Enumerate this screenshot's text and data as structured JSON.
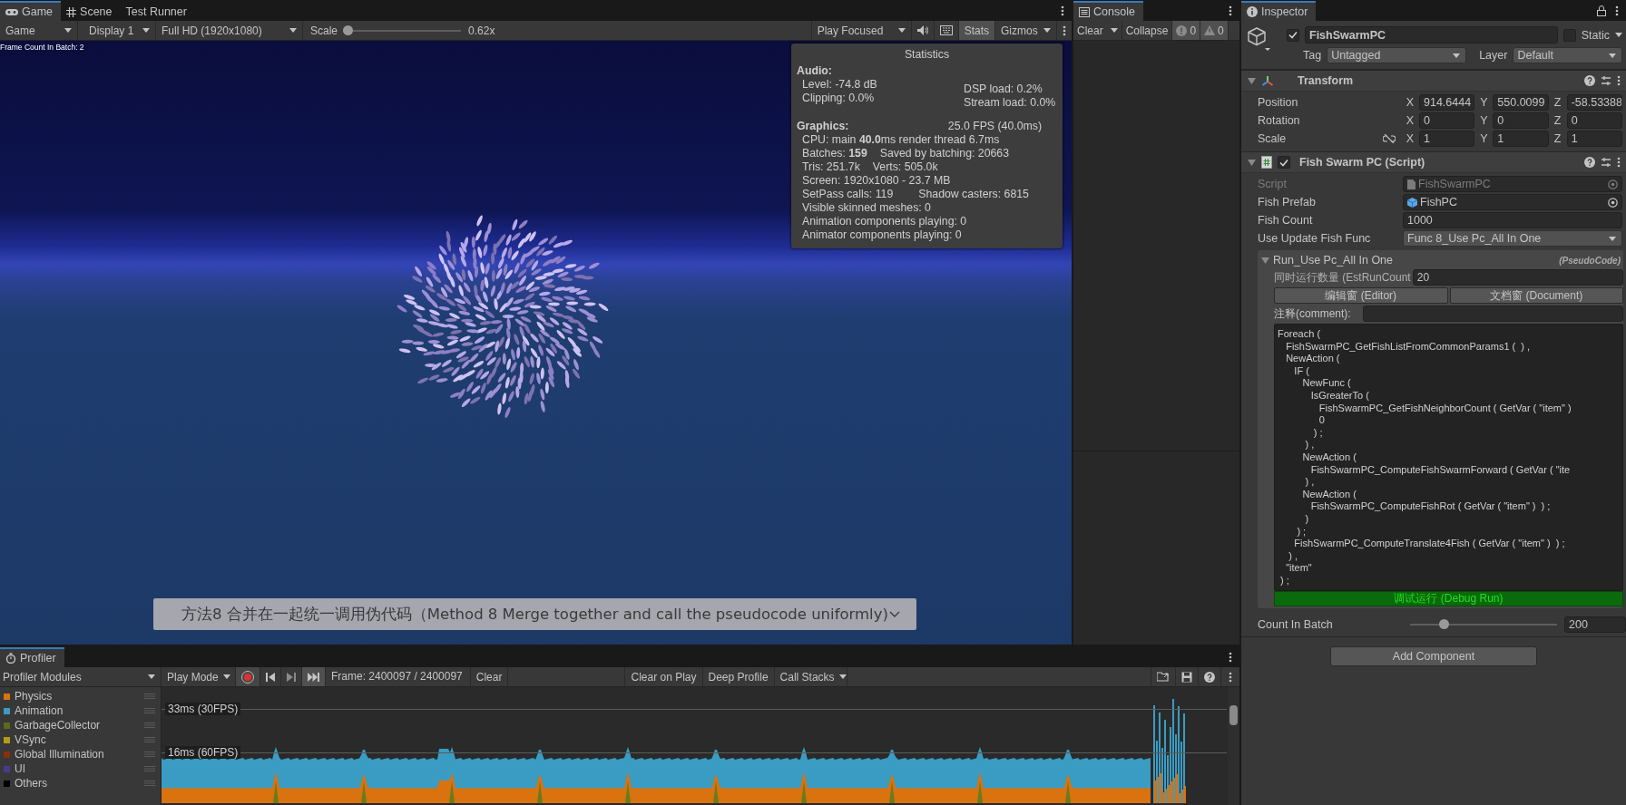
{
  "game": {
    "tabs": [
      {
        "label": "Game",
        "selected": true
      },
      {
        "label": "Scene",
        "selected": false
      },
      {
        "label": "Test Runner",
        "selected": false
      }
    ],
    "toolbar": {
      "view": "Game",
      "display": "Display 1",
      "resolution": "Full HD (1920x1080)",
      "scale_label": "Scale",
      "scale": {
        "level": 0,
        "reading": "0.62x"
      },
      "play_mode": "Play Focused",
      "stats": {
        "label": "Stats",
        "selected": true
      },
      "gizmos": "Gizmos"
    },
    "overlay_text": "Frame Count In Batch: 2",
    "statistics": {
      "title": "Statistics",
      "audio_heading": "Audio:",
      "audio_left": [
        "Level: -74.8 dB",
        "Clipping: 0.0%"
      ],
      "audio_right": [
        "DSP load: 0.2%",
        "Stream load: 0.0%"
      ],
      "graphics_heading": "Graphics:",
      "fps": "25.0 FPS (40.0ms)",
      "rows": [
        [
          "CPU: main **40.0**ms  render thread 6.7ms"
        ],
        [
          "Batches: **159**",
          "Saved by batching: 20663"
        ],
        [
          "Tris: 251.7k",
          "Verts: 505.0k"
        ],
        [
          "Screen: 1920x1080 - 23.7 MB"
        ],
        [
          "SetPass calls: 119",
          "Shadow casters: 6815"
        ],
        [
          "Visible skinned meshes: 0"
        ],
        [
          "Animation components playing: 0"
        ],
        [
          "Animator components playing: 0"
        ]
      ]
    },
    "caption": "方法8 合并在一起统一调用伪代码（Method 8 Merge together and call the pseudocode uniformly)"
  },
  "console": {
    "tab": "Console",
    "clear": "Clear",
    "collapse": "Collapse",
    "errors": "0",
    "warnings": "0"
  },
  "inspector": {
    "tab": "Inspector",
    "object": {
      "active": true,
      "name": "FishSwarmPC",
      "static": false,
      "static_label": "Static",
      "tag_label": "Tag",
      "tag": "Untagged",
      "layer_label": "Layer",
      "layer": "Default"
    },
    "transform": {
      "title": "Transform",
      "expanded": true,
      "rows": [
        {
          "label": "Position",
          "fields": [
            {
              "axis": "X",
              "value": "914.6444"
            },
            {
              "axis": "Y",
              "value": "550.0099"
            },
            {
              "axis": "Z",
              "value": "-58.53388"
            }
          ]
        },
        {
          "label": "Rotation",
          "fields": [
            {
              "axis": "X",
              "value": "0"
            },
            {
              "axis": "Y",
              "value": "0"
            },
            {
              "axis": "Z",
              "value": "0"
            }
          ]
        },
        {
          "label": "Scale",
          "fields": [
            {
              "axis": "X",
              "value": "1"
            },
            {
              "axis": "Y",
              "value": "1"
            },
            {
              "axis": "Z",
              "value": "1"
            }
          ]
        }
      ]
    },
    "script": {
      "title": "Fish Swarm PC (Script)",
      "enabled": true,
      "expanded": true,
      "fields": [
        {
          "kind": "object",
          "label": "Script",
          "value": "FishSwarmPC",
          "disabled": true
        },
        {
          "kind": "object",
          "label": "Fish Prefab",
          "value": "FishPC",
          "disabled": false
        },
        {
          "kind": "text",
          "label": "Fish Count",
          "value": "1000",
          "disabled": false
        },
        {
          "kind": "dropdown",
          "label": "Use Update Fish Func",
          "value": "Func 8_Use Pc_All In One",
          "disabled": false
        }
      ],
      "pseudocode": {
        "title": "Run_Use Pc_All In One",
        "tag": "(PseudoCode)",
        "expanded": true,
        "run_count_label": "同时运行数量 (EstRunCount",
        "run_count": "20",
        "editor_button": "编辑窗 (Editor)",
        "document_button": "文档窗 (Document)",
        "comment_label": "注释(comment):",
        "code": [
          "Foreach (",
          "   FishSwarmPC_GetFishListFromCommonParams1 (  ) ,",
          "   NewAction (",
          "      IF (",
          "         NewFunc (",
          "            IsGreaterTo (",
          "               FishSwarmPC_GetFishNeighborCount ( GetVar ( \"item\" )",
          "               0",
          "             ) ;",
          "          ) ,",
          "         NewAction (",
          "            FishSwarmPC_ComputeFishSwarmForward ( GetVar ( \"ite",
          "          ) ,",
          "         NewAction (",
          "            FishSwarmPC_ComputeFishRot ( GetVar ( \"item\" )  ) ;",
          "          )",
          "       ) ;",
          "      FishSwarmPC_ComputeTranslate4Fish ( GetVar ( \"item\" )  ) ;",
          "    ) ,",
          "   \"item\"",
          " ) ;"
        ],
        "debug_button": "调试运行 (Debug Run)"
      },
      "count_in_batch": {
        "label": "Count In Batch",
        "level": 0.21,
        "reading": "200"
      }
    },
    "add_component": "Add Component"
  },
  "profiler": {
    "tab": "Profiler",
    "modules_label": "Profiler Modules",
    "play_mode": "Play Mode",
    "recording": true,
    "frame": "Frame: 2400097 / 2400097",
    "clear": "Clear",
    "clear_on_play": {
      "label": "Clear on Play",
      "selected": false
    },
    "deep_profile": {
      "label": "Deep Profile",
      "selected": false
    },
    "call_stacks": "Call Stacks",
    "modules": [
      {
        "name": "Physics",
        "color": "#d9720f"
      },
      {
        "name": "Animation",
        "color": "#3a9cc2"
      },
      {
        "name": "GarbageCollector",
        "color": "#5a6a1c"
      },
      {
        "name": "VSync",
        "color": "#b39c14"
      },
      {
        "name": "Global Illumination",
        "color": "#8a2e12"
      },
      {
        "name": "UI",
        "color": "#4b3a8c"
      },
      {
        "name": "Others",
        "color": "#000000"
      }
    ],
    "graph_labels": [
      "33ms (30FPS)",
      "16ms (60FPS)"
    ]
  }
}
